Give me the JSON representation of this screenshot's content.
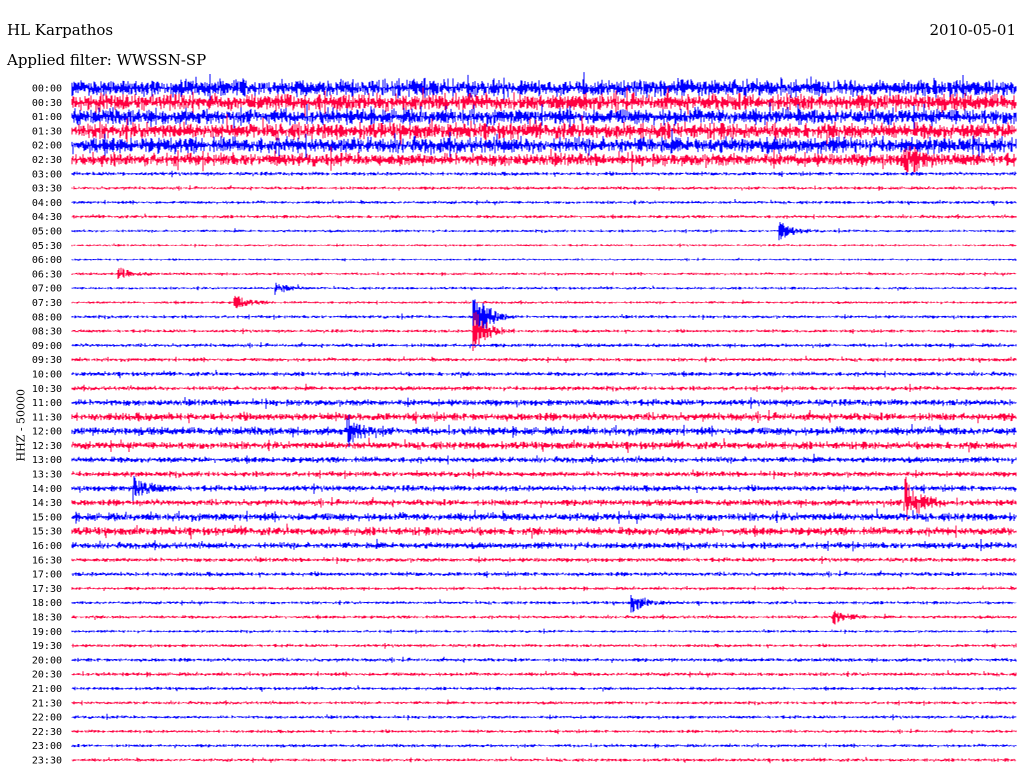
{
  "header": {
    "station": "HL Karpathos",
    "date": "2010-05-01",
    "filter": "Applied filter: WWSSN-SP"
  },
  "chart_data": {
    "type": "line",
    "title": "HL Karpathos",
    "ylabel": "HHZ - 50000",
    "row_minutes": 30,
    "colors": [
      "#0000ff",
      "#ff0040"
    ],
    "row_labels": [
      "00:00",
      "00:30",
      "01:00",
      "01:30",
      "02:00",
      "02:30",
      "03:00",
      "03:30",
      "04:00",
      "04:30",
      "05:00",
      "05:30",
      "06:00",
      "06:30",
      "07:00",
      "07:30",
      "08:00",
      "08:30",
      "09:00",
      "09:30",
      "10:00",
      "10:30",
      "11:00",
      "11:30",
      "12:00",
      "12:30",
      "13:00",
      "13:30",
      "14:00",
      "14:30",
      "15:00",
      "15:30",
      "16:00",
      "16:30",
      "17:00",
      "17:30",
      "18:00",
      "18:30",
      "19:00",
      "19:30",
      "20:00",
      "20:30",
      "21:00",
      "21:30",
      "22:00",
      "22:30",
      "23:00",
      "23:30"
    ],
    "row_noise_level": [
      1.6,
      1.6,
      1.5,
      1.5,
      1.5,
      1.2,
      0.35,
      0.3,
      0.3,
      0.3,
      0.25,
      0.2,
      0.2,
      0.25,
      0.25,
      0.25,
      0.3,
      0.3,
      0.35,
      0.35,
      0.4,
      0.4,
      0.6,
      0.75,
      0.75,
      0.7,
      0.55,
      0.5,
      0.55,
      0.6,
      0.75,
      0.75,
      0.6,
      0.4,
      0.4,
      0.3,
      0.3,
      0.3,
      0.25,
      0.3,
      0.35,
      0.35,
      0.3,
      0.3,
      0.3,
      0.3,
      0.3,
      0.3
    ],
    "events": [
      {
        "row": 5,
        "minute": 26.5,
        "amplitude": 2.0
      },
      {
        "row": 10,
        "minute": 22.5,
        "amplitude": 1.2
      },
      {
        "row": 13,
        "minute": 1.5,
        "amplitude": 0.8
      },
      {
        "row": 14,
        "minute": 6.5,
        "amplitude": 0.8
      },
      {
        "row": 15,
        "minute": 5.2,
        "amplitude": 1.0
      },
      {
        "row": 16,
        "minute": 12.8,
        "amplitude": 4.0
      },
      {
        "row": 17,
        "minute": 12.8,
        "amplitude": 3.0
      },
      {
        "row": 24,
        "minute": 8.8,
        "amplitude": 2.0
      },
      {
        "row": 28,
        "minute": 2.0,
        "amplitude": 1.5
      },
      {
        "row": 29,
        "minute": 26.5,
        "amplitude": 3.5
      },
      {
        "row": 36,
        "minute": 17.8,
        "amplitude": 1.3
      },
      {
        "row": 37,
        "minute": 24.2,
        "amplitude": 1.0
      }
    ]
  }
}
